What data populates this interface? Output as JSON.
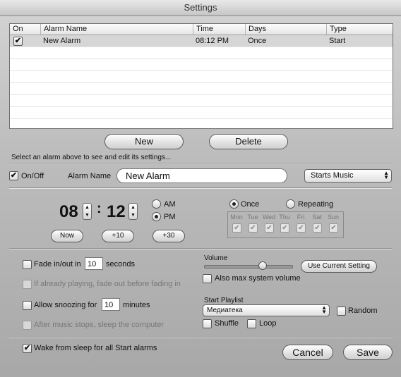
{
  "window": {
    "title": "Settings"
  },
  "table": {
    "columns": [
      "On",
      "Alarm Name",
      "Time",
      "Days",
      "Type"
    ],
    "rows": [
      {
        "on": true,
        "name": "New Alarm",
        "time": "08:12 PM",
        "days": "Once",
        "type": "Start"
      }
    ]
  },
  "buttons": {
    "new": "New",
    "delete": "Delete",
    "now": "Now",
    "plus10": "+10",
    "plus30": "+30",
    "use_current": "Use Current Setting",
    "cancel": "Cancel",
    "save": "Save"
  },
  "hint": "Select an alarm above to see and edit its settings...",
  "alarm": {
    "onoff_label": "On/Off",
    "onoff_checked": true,
    "name_label": "Alarm Name",
    "name_value": "New Alarm",
    "type_popup": "Starts Music",
    "hour": "08",
    "colon": ":",
    "minute": "12",
    "am_label": "AM",
    "pm_label": "PM",
    "meridiem": "PM",
    "once_label": "Once",
    "repeating_label": "Repeating",
    "recurrence": "Once",
    "days": [
      "Mon",
      "Tue",
      "Wed",
      "Thu",
      "Fri",
      "Sat",
      "Sun"
    ]
  },
  "options": {
    "fade_label": "Fade in/out in",
    "fade_value": "10",
    "fade_unit": "seconds",
    "fade_playing_label": "If already playing, fade out before fading in",
    "snooze_label": "Allow snoozing for",
    "snooze_value": "10",
    "snooze_unit": "minutes",
    "sleep_label": "After music stops, sleep the computer",
    "volume_label": "Volume",
    "volume_level": 0.66,
    "max_volume_label": "Also max system volume",
    "playlist_label": "Start Playlist",
    "playlist_value": "Медиатека",
    "random_label": "Random",
    "shuffle_label": "Shuffle",
    "loop_label": "Loop",
    "wake_label": "Wake from sleep for all Start alarms",
    "wake_checked": true
  }
}
